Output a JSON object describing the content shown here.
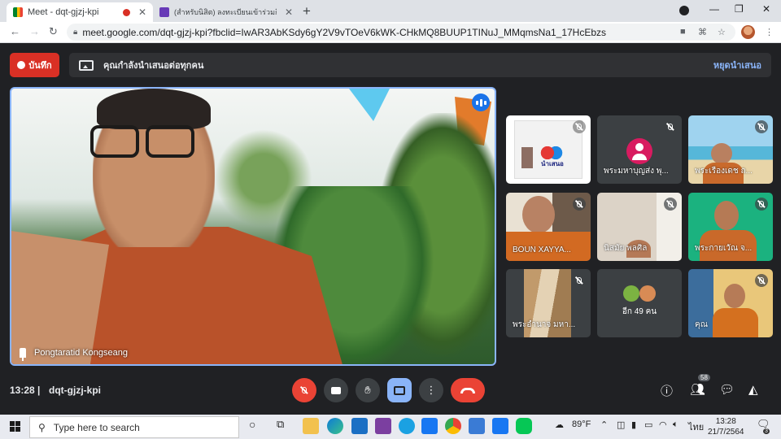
{
  "browser": {
    "tabs": [
      {
        "title": "Meet - dqt-gjzj-kpi",
        "active": true,
        "recording": true
      },
      {
        "title": "(สำหรับนิสิต) ลงทะเบียนเข้าร่วมกิจกรรม",
        "active": false
      }
    ],
    "new_tab_label": "+",
    "url": "meet.google.com/dqt-gjzj-kpi?fbclid=IwAR3AbKSdy6gY2V9vTOeV6kWK-CHkMQ8BUUP1TINuJ_MMqmsNa1_17HcEbzs"
  },
  "banner": {
    "record_label": "บันทึก",
    "presenting_text": "คุณกำลังนำเสนอต่อทุกคน",
    "stop_presenting_label": "หยุดนำเสนอ"
  },
  "main_tile": {
    "name": "Pongtaratid Kongseang"
  },
  "tiles": [
    {
      "name": ""
    },
    {
      "name": "พระมหาบุญส่ง พุ..."
    },
    {
      "name": "พระเรืองเดช ถ..."
    },
    {
      "name": "BOUN XAYYA..."
    },
    {
      "name": "นิสมัย พลศิล"
    },
    {
      "name": "พระกายเวัณ จ..."
    },
    {
      "name": "พระอำนาจ มหา..."
    },
    {
      "name": "อีก 49 คน"
    },
    {
      "name": "คุณ"
    }
  ],
  "slide_thumb_text": "นำเสนอ",
  "meeting": {
    "time": "13:28",
    "code": "dqt-gjzj-kpi",
    "participants_count": "58"
  },
  "taskbar": {
    "search_placeholder": "Type here to search",
    "weather": "89°F",
    "lang": "ไทย",
    "time": "13:28",
    "date": "21/7/2564",
    "notif_count": "3"
  },
  "colors": {
    "meet_bg": "#202124",
    "accent_blue": "#8ab4f8",
    "end_red": "#ea4335"
  }
}
